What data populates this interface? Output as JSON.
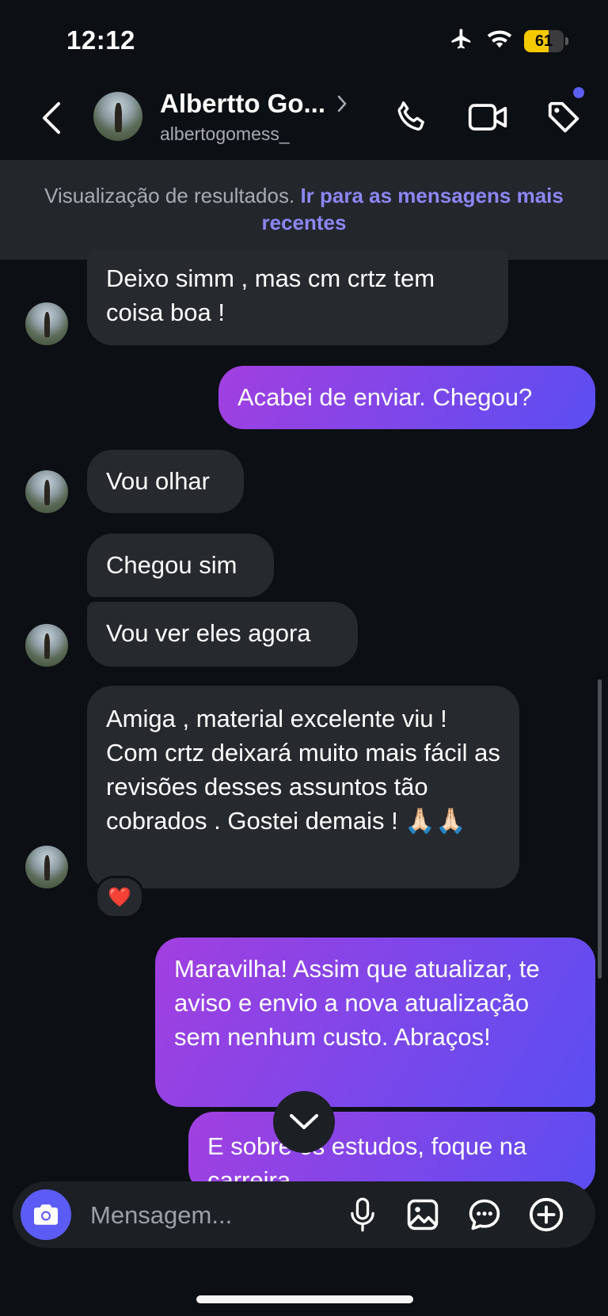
{
  "status_bar": {
    "time": "12:12",
    "battery_level": "61",
    "battery_percent": 61,
    "icons": [
      "airplane-icon",
      "wifi-icon",
      "battery-icon"
    ]
  },
  "header": {
    "contact_name": "Albertto Go...",
    "contact_handle": "albertogomess_",
    "icons": [
      "back-icon",
      "chevron-right-icon",
      "phone-icon",
      "video-icon",
      "tag-icon"
    ]
  },
  "banner": {
    "text": "Visualização de resultados.",
    "link": "Ir para as mensagens mais recentes"
  },
  "messages": [
    {
      "from": "contact",
      "text": "Deixo simm , mas cm crtz tem coisa boa !"
    },
    {
      "from": "me",
      "text": "Acabei de enviar.  Chegou?"
    },
    {
      "from": "contact",
      "text": "Vou olhar"
    },
    {
      "from": "contact",
      "text": "Chegou sim"
    },
    {
      "from": "contact",
      "text": "Vou ver eles agora"
    },
    {
      "from": "contact",
      "text": "Amiga , material excelente viu ! Com crtz deixará muito mais fácil as revisões desses assuntos tão cobrados . Gostei demais ! 🙏🏻🙏🏻",
      "reaction": "❤️"
    },
    {
      "from": "me",
      "text": "Maravilha! Assim que atualizar, te aviso e envio a nova atualização sem nenhum custo. Abraços!"
    },
    {
      "from": "me",
      "text": "E sobre os estudos, foque na carreira"
    }
  ],
  "composer": {
    "placeholder": "Mensagem...",
    "icons": [
      "camera-icon",
      "microphone-icon",
      "image-icon",
      "sticker-icon",
      "plus-icon"
    ]
  },
  "colors": {
    "background": "#0c0f13",
    "incoming_bubble": "#26292e",
    "outgoing_start": "#a23fe0",
    "outgoing_end": "#5b4ef2",
    "accent": "#5b5cf5",
    "link": "#8c86f6"
  }
}
